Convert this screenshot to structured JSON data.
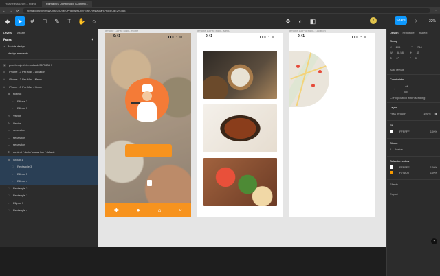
{
  "browser": {
    "tabs": [
      "Yoav Restaurant – Figma",
      "Figma iOS UI Kit (Grid) (Commu..."
    ],
    "url": "figma.com/file/fmWQ8iCGtUTsyJPRdMwFDxv/Yoav-Restaurant?node-id=2%3A3"
  },
  "toolbar": {
    "share_label": "Share",
    "zoom": "22%",
    "avatar_initial": "Y"
  },
  "left_panel": {
    "tabs": [
      "Layers",
      "Assets"
    ],
    "page_selector": "Mobile design",
    "pages_title": "Pages",
    "pages": [
      "Mobile design",
      "design elements"
    ],
    "layers": [
      {
        "label": "pexels-rajesh-tp-muhadi-3673634 1",
        "icon": "image-icon",
        "indent": 0,
        "selected": false
      },
      {
        "label": "iPhone 13 Pro Max - Location",
        "icon": "frame-icon",
        "indent": 0,
        "selected": false
      },
      {
        "label": "iPhone 13 Pro Max - Menu",
        "icon": "frame-icon",
        "indent": 0,
        "selected": false
      },
      {
        "label": "iPhone 13 Pro Max - Home",
        "icon": "frame-icon",
        "indent": 0,
        "selected": false
      },
      {
        "label": "footnot",
        "icon": "group-icon",
        "indent": 1,
        "selected": false
      },
      {
        "label": "Ellipse 2",
        "icon": "ellipse-icon",
        "indent": 2,
        "selected": false
      },
      {
        "label": "Ellipse 3",
        "icon": "ellipse-icon",
        "indent": 2,
        "selected": false
      },
      {
        "label": "Vector",
        "icon": "vector-icon",
        "indent": 1,
        "selected": false
      },
      {
        "label": "Vector",
        "icon": "vector-icon",
        "indent": 1,
        "selected": false
      },
      {
        "label": "separator",
        "icon": "line-icon",
        "indent": 1,
        "selected": false
      },
      {
        "label": "separator",
        "icon": "line-icon",
        "indent": 1,
        "selected": false
      },
      {
        "label": "separator",
        "icon": "line-icon",
        "indent": 1,
        "selected": false
      },
      {
        "label": "content / dark / status bar / default",
        "icon": "component-icon",
        "indent": 1,
        "selected": false
      },
      {
        "label": "Group 1",
        "icon": "group-icon",
        "indent": 1,
        "selected": true
      },
      {
        "label": "Rectangle 3",
        "icon": "rectangle-icon",
        "indent": 2,
        "selected": true
      },
      {
        "label": "Ellipse 5",
        "icon": "ellipse-icon",
        "indent": 2,
        "selected": true
      },
      {
        "label": "Ellipse 4",
        "icon": "ellipse-icon",
        "indent": 2,
        "selected": true
      },
      {
        "label": "Rectangle 2",
        "icon": "rectangle-icon",
        "indent": 1,
        "selected": false
      },
      {
        "label": "Rectangle 1",
        "icon": "rectangle-icon",
        "indent": 1,
        "selected": false
      },
      {
        "label": "Ellipse 1",
        "icon": "ellipse-icon",
        "indent": 1,
        "selected": false
      },
      {
        "label": "Rectangle 4",
        "icon": "rectangle-icon",
        "indent": 1,
        "selected": false
      }
    ]
  },
  "canvas": {
    "frames": [
      {
        "label": "iPhone 13 Pro Max - Home",
        "time": "9:41"
      },
      {
        "label": "iPhone 13 Pro Max - Menu",
        "time": "9:41"
      },
      {
        "label": "iPhone 13 Pro Max - Location",
        "time": "9:41"
      }
    ]
  },
  "right_panel": {
    "tabs": [
      "Design",
      "Prototype",
      "Inspect"
    ],
    "group_title": "Group",
    "x": "206",
    "y": "744",
    "w": "38.58",
    "h": "45",
    "rotation": "0°",
    "radius": "0",
    "auto_layout": "Auto layout",
    "constraints_title": "Constraints",
    "constraint_h": "Left",
    "constraint_v": "Top",
    "fix_scroll": "Fix position when scrolling",
    "layer_title": "Layer",
    "blend": "Pass through",
    "opacity": "100%",
    "fill_title": "Fill",
    "fill_hex": "FFFFFF",
    "fill_opacity": "100%",
    "stroke_title": "Stroke",
    "stroke_weight": "1",
    "stroke_position": "Inside",
    "selection_colors_title": "Selection colors",
    "sel_colors": [
      {
        "hex": "FFFFFF",
        "opacity": "100%",
        "swatch": "#ffffff"
      },
      {
        "hex": "F79A00",
        "opacity": "100%",
        "swatch": "#f79a00"
      }
    ],
    "effects_title": "Effects",
    "export_title": "Export"
  },
  "colors": {
    "accent": "#0d99ff",
    "brand_orange": "#f7931e"
  }
}
